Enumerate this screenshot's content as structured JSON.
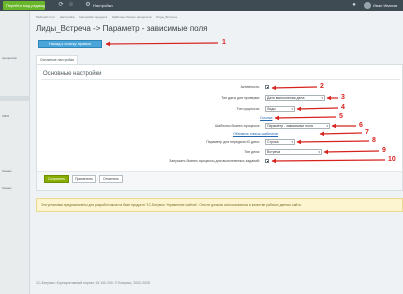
{
  "topbar": {
    "start_button": "Перейти мод редакции",
    "settings_label": "Настройки",
    "user_name": "Иван Иванов"
  },
  "sidebar": {
    "items": [
      {
        "label": "процессов"
      },
      {
        "label": "CRM"
      },
      {
        "label": "бизнес"
      },
      {
        "label": "бизнес"
      }
    ]
  },
  "breadcrumb": [
    "Рабочий стол",
    "Настройки",
    "Настройки продукта",
    "Шаблоны бизнес-процессов",
    "Лиды_Встреча"
  ],
  "page": {
    "title": "Лиды_Встреча -> Параметр - зависимые поля"
  },
  "back_button": "Назад к списку правил",
  "tabs": [
    {
      "label": "Основные настройки"
    }
  ],
  "card": {
    "title": "Основные настройки"
  },
  "form": {
    "active": {
      "label": "Активность:",
      "checked": true
    },
    "check_date_type": {
      "label": "Тип даты для проверки:",
      "value": "Дата выполнения дела"
    },
    "entity_type": {
      "label": "Тип сущности:",
      "value": "Лиды"
    },
    "link_text": "Ссылка",
    "template": {
      "label": "Шаблоны бизнес-процесса:",
      "value": "Параметр - зависимые поля"
    },
    "update_link": "Обновить список шаблонов",
    "date_param": {
      "label": "Параметр для передачи ID даты:",
      "value": "Строка"
    },
    "date_type": {
      "label": "Тип дела:",
      "value": "Встреча"
    },
    "run_completed": {
      "label": "Запускать бизнес-процессы для выполненных заданий:",
      "checked": true
    }
  },
  "buttons": {
    "save": "Сохранить",
    "apply": "Применить",
    "cancel": "Отменить"
  },
  "warning": "Эти установки предназначены для разработчиков на базе продукта \"1С-Битрикс: Управление сайтом\". Они не должны использоваться в качестве рабочих данных сайта.",
  "footer": {
    "copyright": "1С-Битрикс: Корпоративный портал 15.100.200. © Битрикс, 2002-2025"
  },
  "annotations": [
    "1",
    "2",
    "3",
    "4",
    "5",
    "6",
    "7",
    "8",
    "9",
    "10"
  ],
  "colors": {
    "accent": "#d7231f",
    "save": "#86ad00",
    "back": "#4aa5d8",
    "topbar": "#3f4b53"
  }
}
